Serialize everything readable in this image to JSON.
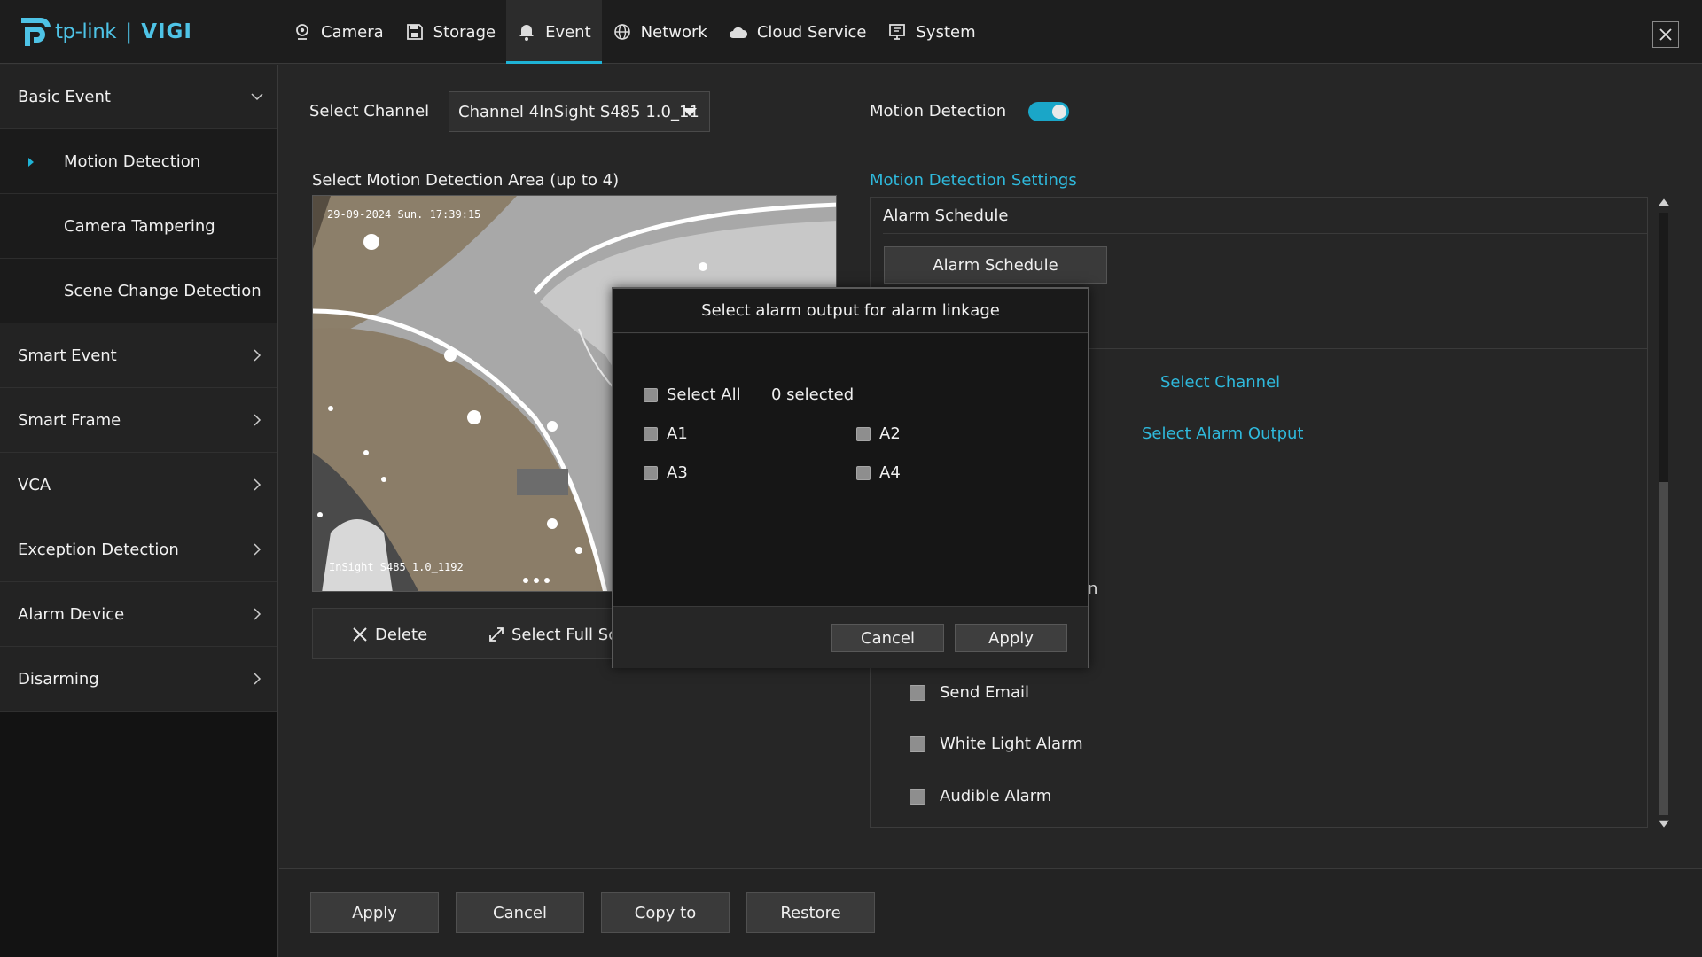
{
  "brand": {
    "tp": "tp-link",
    "separator": "|",
    "product": "VIGI"
  },
  "nav": [
    {
      "label": "Camera",
      "icon": "camera-icon",
      "active": false
    },
    {
      "label": "Storage",
      "icon": "storage-icon",
      "active": false
    },
    {
      "label": "Event",
      "icon": "bell-icon",
      "active": true
    },
    {
      "label": "Network",
      "icon": "globe-icon",
      "active": false
    },
    {
      "label": "Cloud Service",
      "icon": "cloud-icon",
      "active": false
    },
    {
      "label": "System",
      "icon": "monitor-icon",
      "active": false
    }
  ],
  "sidebar": {
    "basic_event": "Basic Event",
    "sub_items": [
      "Motion Detection",
      "Camera Tampering",
      "Scene Change Detection"
    ],
    "groups": [
      "Smart Event",
      "Smart Frame",
      "VCA",
      "Exception Detection",
      "Alarm Device",
      "Disarming"
    ]
  },
  "main": {
    "select_channel_label": "Select Channel",
    "channel_value": "Channel 4InSight S485 1.0_11",
    "motion_detection_label": "Motion Detection",
    "motion_detection_enabled": true,
    "area_label": "Select Motion Detection Area (up to 4)",
    "osd_time": "29-09-2024 Sun. 17:39:15",
    "osd_name": "InSight S485 1.0_1192",
    "delete_label": "Delete",
    "select_full_label": "Select Full Sc"
  },
  "settings": {
    "title": "Motion Detection Settings",
    "schedule_header": "Alarm Schedule",
    "schedule_button": "Alarm Schedule",
    "select_channel_link": "Select Channel",
    "select_alarm_output_link": "Select Alarm Output",
    "partial_char": "n",
    "options": [
      "Send Email",
      "White Light Alarm",
      "Audible Alarm"
    ]
  },
  "footer": {
    "apply": "Apply",
    "cancel": "Cancel",
    "copy_to": "Copy to",
    "restore": "Restore"
  },
  "modal": {
    "title": "Select alarm output for alarm linkage",
    "select_all": "Select All",
    "selected_count": "0 selected",
    "outputs": [
      "A1",
      "A2",
      "A3",
      "A4"
    ],
    "cancel": "Cancel",
    "apply": "Apply"
  },
  "colors": {
    "accent": "#1fb3d6",
    "link": "#2fb9dc",
    "background": "#262626",
    "sidebar": "#131313"
  }
}
